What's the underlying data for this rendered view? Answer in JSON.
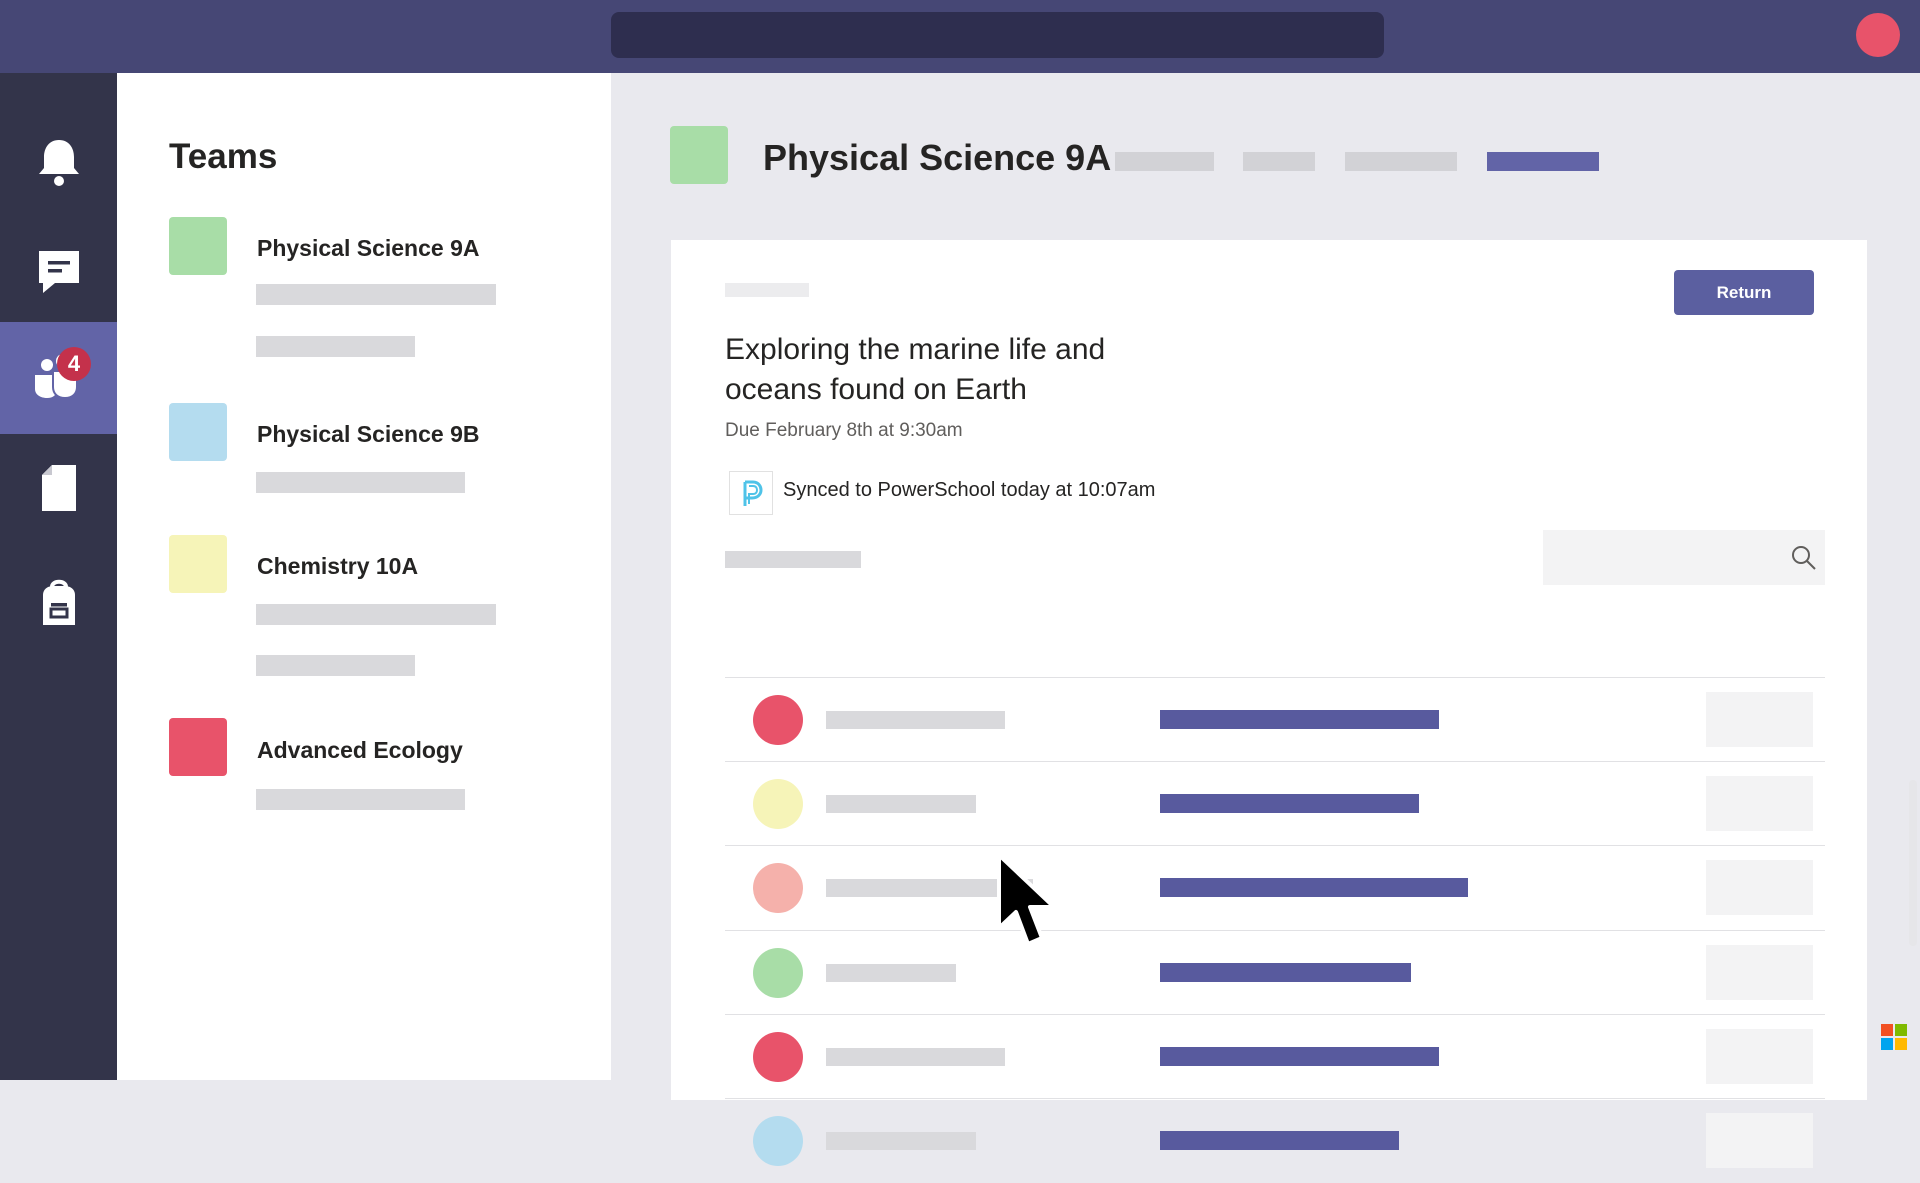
{
  "teams_panel": {
    "title": "Teams",
    "items": [
      {
        "name": "Physical Science 9A",
        "color": "#a8dda7"
      },
      {
        "name": "Physical Science 9B",
        "color": "#b4dcef"
      },
      {
        "name": "Chemistry 10A",
        "color": "#f6f4b8"
      },
      {
        "name": "Advanced Ecology",
        "color": "#e8536a"
      }
    ]
  },
  "rail": {
    "items": [
      "bell-icon",
      "chat-icon",
      "teams-icon",
      "files-icon",
      "backpack-icon"
    ],
    "teams_badge": "4",
    "active_item": "teams-icon"
  },
  "channel": {
    "title": "Physical Science 9A",
    "color": "#a8dda7"
  },
  "assignment": {
    "title": "Exploring the marine life and oceans found on Earth",
    "due": "Due February 8th at 9:30am",
    "sync_status": "Synced to PowerSchool today at 10:07am",
    "return_label": "Return"
  },
  "student_list": {
    "avatar_colors": [
      "#e8536a",
      "#f6f4b8",
      "#f5b1ab",
      "#a8dda7",
      "#e8536a",
      "#b4dcef"
    ]
  },
  "colors": {
    "top_bar": "#464775",
    "rail": "#33344a",
    "accent": "#6264a7",
    "button": "#5b5fa0"
  }
}
